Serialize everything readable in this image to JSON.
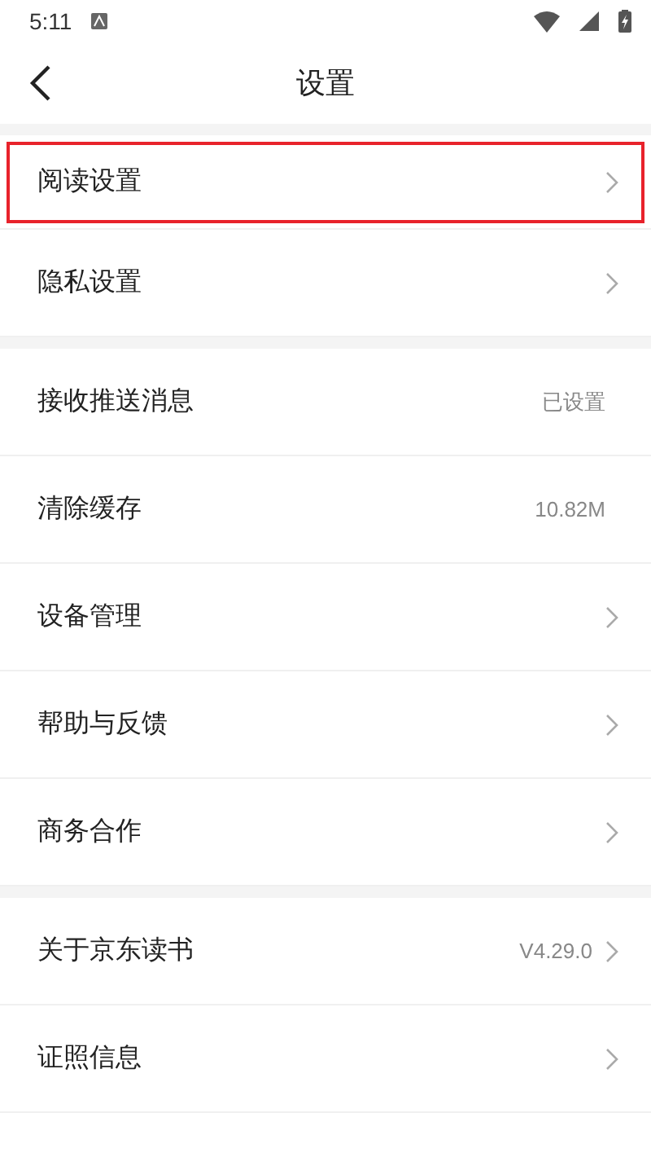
{
  "status_bar": {
    "time": "5:11"
  },
  "header": {
    "title": "设置"
  },
  "groups": [
    {
      "rows": [
        {
          "label": "阅读设置",
          "chevron": true,
          "highlighted": true
        },
        {
          "label": "隐私设置",
          "chevron": true,
          "highlighted": false
        }
      ]
    },
    {
      "rows": [
        {
          "label": "接收推送消息",
          "value": "已设置",
          "chevron": false,
          "highlighted": false
        },
        {
          "label": "清除缓存",
          "value": "10.82M",
          "chevron": false,
          "highlighted": false
        },
        {
          "label": "设备管理",
          "chevron": true,
          "highlighted": false
        },
        {
          "label": "帮助与反馈",
          "chevron": true,
          "highlighted": false
        },
        {
          "label": "商务合作",
          "chevron": true,
          "highlighted": false
        }
      ]
    },
    {
      "rows": [
        {
          "label": "关于京东读书",
          "value": "V4.29.0",
          "chevron": true,
          "highlighted": false
        },
        {
          "label": "证照信息",
          "chevron": true,
          "highlighted": false
        }
      ]
    }
  ]
}
